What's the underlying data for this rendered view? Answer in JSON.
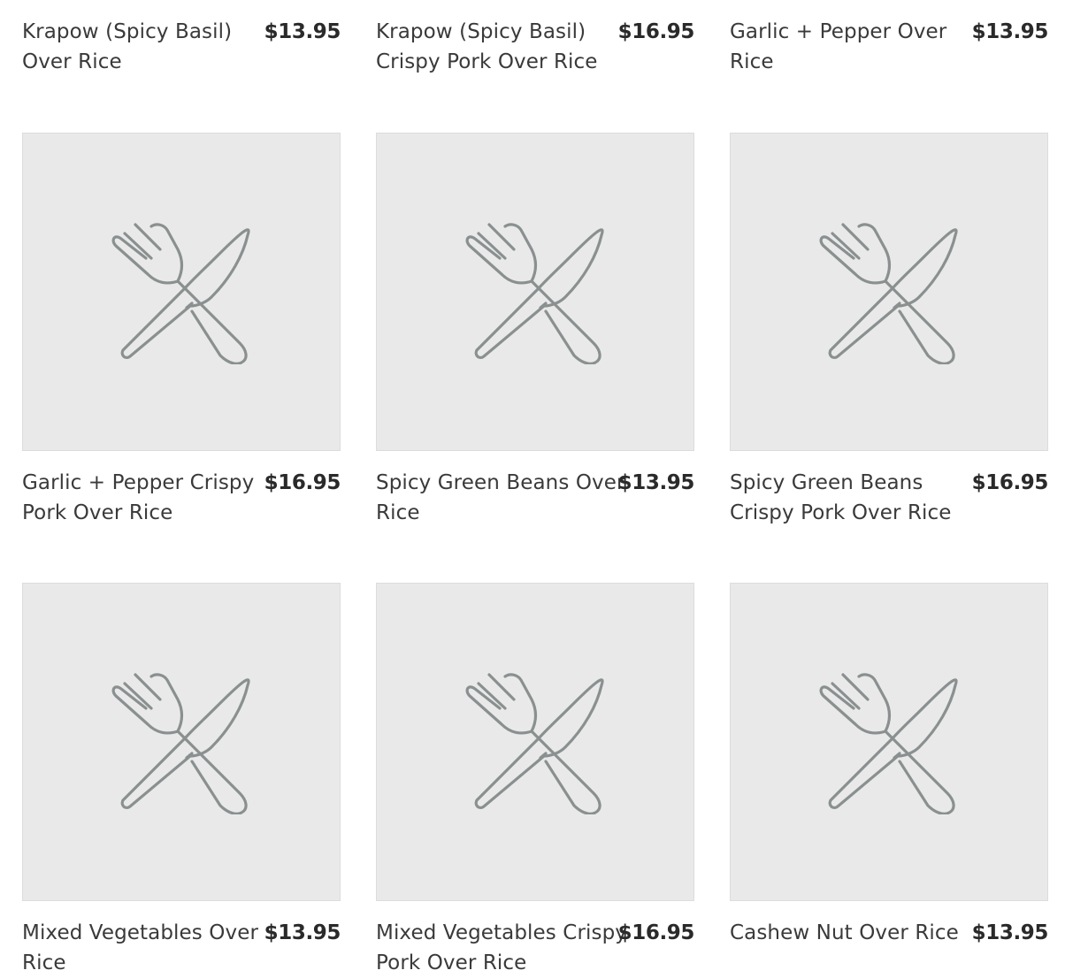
{
  "menu": {
    "items": [
      {
        "name": "Krapow (Spicy Basil) Over Rice",
        "price": "$13.95",
        "image": "utensils-placeholder-icon"
      },
      {
        "name": "Krapow (Spicy Basil) Crispy Pork Over Rice",
        "price": "$16.95",
        "image": "utensils-placeholder-icon"
      },
      {
        "name": "Garlic + Pepper Over Rice",
        "price": "$13.95",
        "image": "utensils-placeholder-icon"
      },
      {
        "name": "Garlic + Pepper Crispy Pork Over Rice",
        "price": "$16.95",
        "image": "utensils-placeholder-icon"
      },
      {
        "name": "Spicy Green Beans Over Rice",
        "price": "$13.95",
        "image": "utensils-placeholder-icon"
      },
      {
        "name": "Spicy Green Beans Crispy Pork Over Rice",
        "price": "$16.95",
        "image": "utensils-placeholder-icon"
      },
      {
        "name": "Mixed Vegetables Over Rice",
        "price": "$13.95",
        "image": "utensils-placeholder-icon"
      },
      {
        "name": "Mixed Vegetables Crispy Pork Over Rice",
        "price": "$16.95",
        "image": "utensils-placeholder-icon"
      },
      {
        "name": "Cashew Nut Over Rice",
        "price": "$13.95",
        "image": "utensils-placeholder-icon"
      }
    ]
  },
  "colors": {
    "placeholder_bg": "#e9e9e9",
    "icon_stroke": "#8a9090",
    "text": "#3a3a3a",
    "price": "#2a2a2a"
  }
}
